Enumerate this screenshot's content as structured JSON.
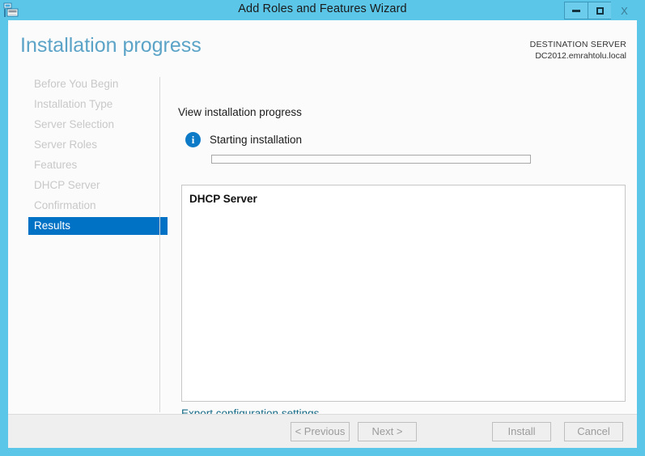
{
  "window": {
    "title": "Add Roles and Features Wizard",
    "icon": "server-wizard-icon",
    "controls": {
      "minimize_label": "Minimize",
      "maximize_label": "Maximize",
      "close_label": "X"
    },
    "titlebar_color": "#5BC6E8"
  },
  "header": {
    "page_title": "Installation progress",
    "destination_label": "DESTINATION SERVER",
    "destination_value": "DC2012.emrahtolu.local",
    "title_color": "#5BA3C7"
  },
  "sidebar": {
    "items": [
      {
        "label": "Before You Begin",
        "selected": false
      },
      {
        "label": "Installation Type",
        "selected": false
      },
      {
        "label": "Server Selection",
        "selected": false
      },
      {
        "label": "Server Roles",
        "selected": false
      },
      {
        "label": "Features",
        "selected": false
      },
      {
        "label": "DHCP Server",
        "selected": false
      },
      {
        "label": "Confirmation",
        "selected": false
      },
      {
        "label": "Results",
        "selected": true
      }
    ],
    "selected_color": "#0072C6",
    "disabled_color": "#c8c8c8"
  },
  "main": {
    "section_title": "View installation progress",
    "status_icon": "info-icon",
    "status_icon_glyph": "i",
    "status_text": "Starting installation",
    "progress_percent": 0,
    "results": [
      {
        "label": "DHCP Server"
      }
    ],
    "export_link": "Export configuration settings",
    "link_color": "#176b87"
  },
  "footer": {
    "buttons": [
      {
        "label": "< Previous",
        "enabled": false
      },
      {
        "label": "Next >",
        "enabled": false
      },
      {
        "label": "Install",
        "enabled": false
      },
      {
        "label": "Cancel",
        "enabled": false
      }
    ]
  }
}
